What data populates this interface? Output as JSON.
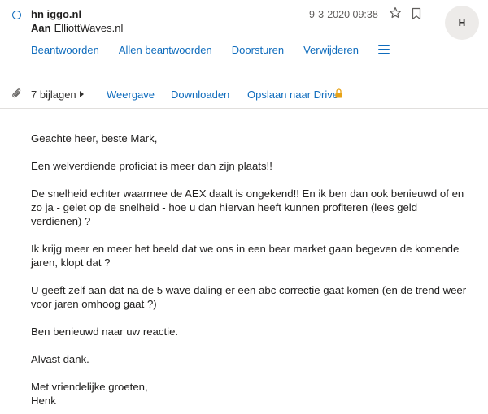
{
  "message": {
    "sender": "hn         iggo.nl",
    "to_label": "Aan",
    "to_value": "ElliottWaves.nl",
    "date": "9-3-2020 09:38",
    "avatar_initial": "H"
  },
  "actions": {
    "reply": "Beantwoorden",
    "reply_all": "Allen beantwoorden",
    "forward": "Doorsturen",
    "delete": "Verwijderen"
  },
  "attachments": {
    "count_label": "7 bijlagen",
    "view": "Weergave",
    "download": "Downloaden",
    "save_drive": "Opslaan naar Drive"
  },
  "body": {
    "greeting": "Geachte heer, beste Mark,",
    "p1": "Een welverdiende proficiat is meer dan zijn plaats!!",
    "p2": "De snelheid echter waarmee de AEX daalt is ongekend!! En ik ben dan ook benieuwd of en zo ja - gelet op de snelheid - hoe u dan hiervan heeft kunnen profiteren (lees geld verdienen) ?",
    "p3": "Ik krijg meer en meer het beeld dat we ons in een bear market gaan begeven de komende jaren, klopt dat ?",
    "p4": "U geeft zelf  aan dat na de 5 wave daling er een abc correctie gaat komen (en de trend weer voor jaren omhoog gaat ?)",
    "p5": "Ben benieuwd naar uw reactie.",
    "p6": "Alvast dank.",
    "closing": "Met vriendelijke groeten,",
    "signature": "Henk"
  },
  "colors": {
    "accent": "#0f6cbd",
    "lock": "#e8a317",
    "text": "#201f1e",
    "avatar_bg": "#edebe9"
  }
}
